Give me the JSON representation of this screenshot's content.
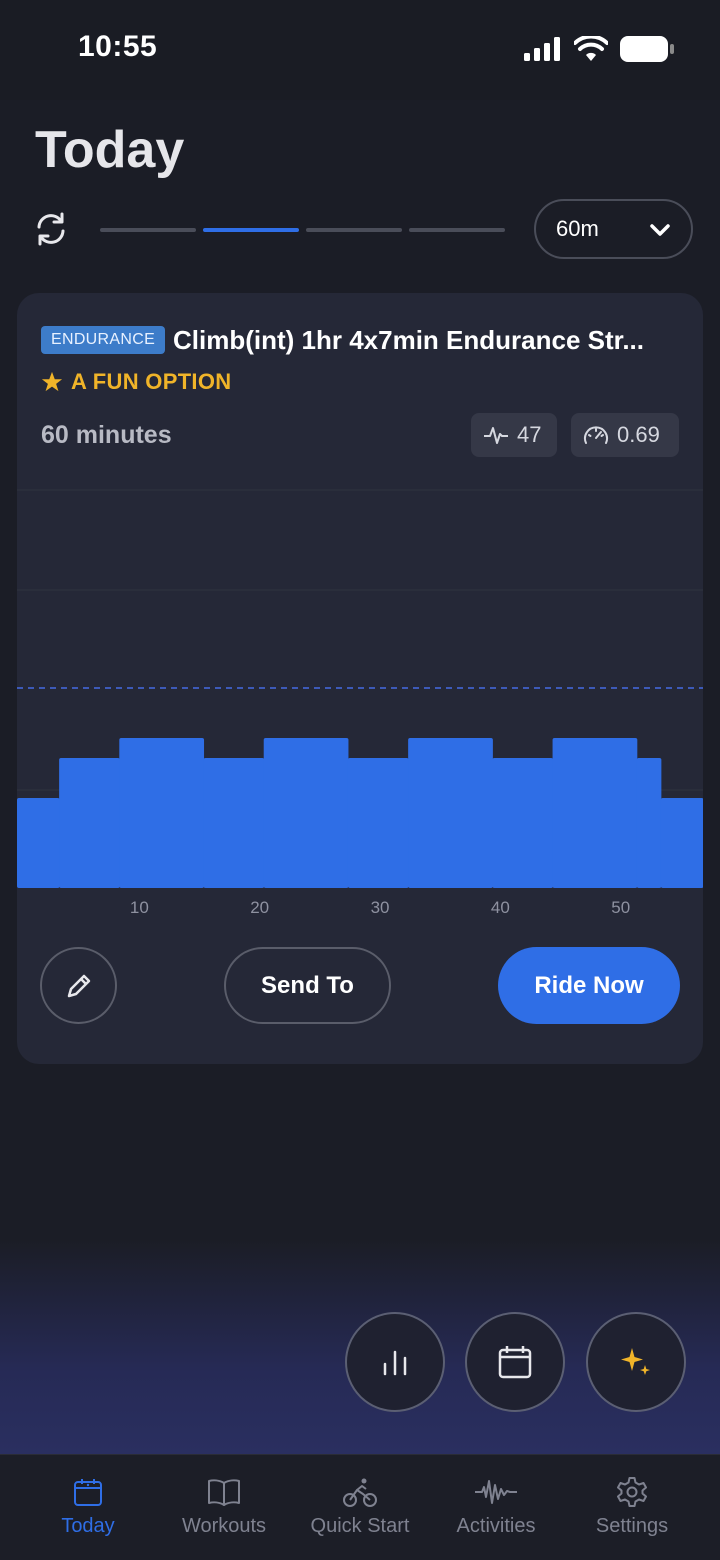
{
  "status_bar": {
    "time": "10:55"
  },
  "header": {
    "title": "Today",
    "duration_selected": "60m"
  },
  "workout": {
    "badge": "ENDURANCE",
    "title": "Climb(int) 1hr 4x7min Endurance Str...",
    "tag": "A FUN OPTION",
    "duration": "60 minutes",
    "tss": "47",
    "intensity_factor": "0.69"
  },
  "chart_data": {
    "type": "area",
    "x_ticks": [
      "10",
      "20",
      "30",
      "40",
      "50"
    ],
    "xlim": [
      0,
      57
    ],
    "segments": [
      {
        "start": 0,
        "end": 3.5,
        "level": 0.45
      },
      {
        "start": 3.5,
        "end": 8.5,
        "level": 0.65
      },
      {
        "start": 8.5,
        "end": 15.5,
        "level": 0.75
      },
      {
        "start": 15.5,
        "end": 20.5,
        "level": 0.65
      },
      {
        "start": 20.5,
        "end": 27.5,
        "level": 0.75
      },
      {
        "start": 27.5,
        "end": 32.5,
        "level": 0.65
      },
      {
        "start": 32.5,
        "end": 39.5,
        "level": 0.75
      },
      {
        "start": 39.5,
        "end": 44.5,
        "level": 0.65
      },
      {
        "start": 44.5,
        "end": 51.5,
        "level": 0.75
      },
      {
        "start": 51.5,
        "end": 53.5,
        "level": 0.65
      },
      {
        "start": 53.5,
        "end": 57,
        "level": 0.45
      }
    ],
    "ftp_line": 1.0,
    "ymax": 2.0,
    "grid": true,
    "color": "#2f6ee6"
  },
  "actions": {
    "send_to": "Send To",
    "ride_now": "Ride Now"
  },
  "tabs": [
    {
      "label": "Today",
      "icon": "calendar-icon",
      "active": true
    },
    {
      "label": "Workouts",
      "icon": "book-icon",
      "active": false
    },
    {
      "label": "Quick Start",
      "icon": "cyclist-icon",
      "active": false
    },
    {
      "label": "Activities",
      "icon": "waveform-icon",
      "active": false
    },
    {
      "label": "Settings",
      "icon": "gear-icon",
      "active": false
    }
  ],
  "colors": {
    "accent": "#2f6ee6",
    "star": "#f0b429",
    "badge": "#3d7cc9"
  }
}
